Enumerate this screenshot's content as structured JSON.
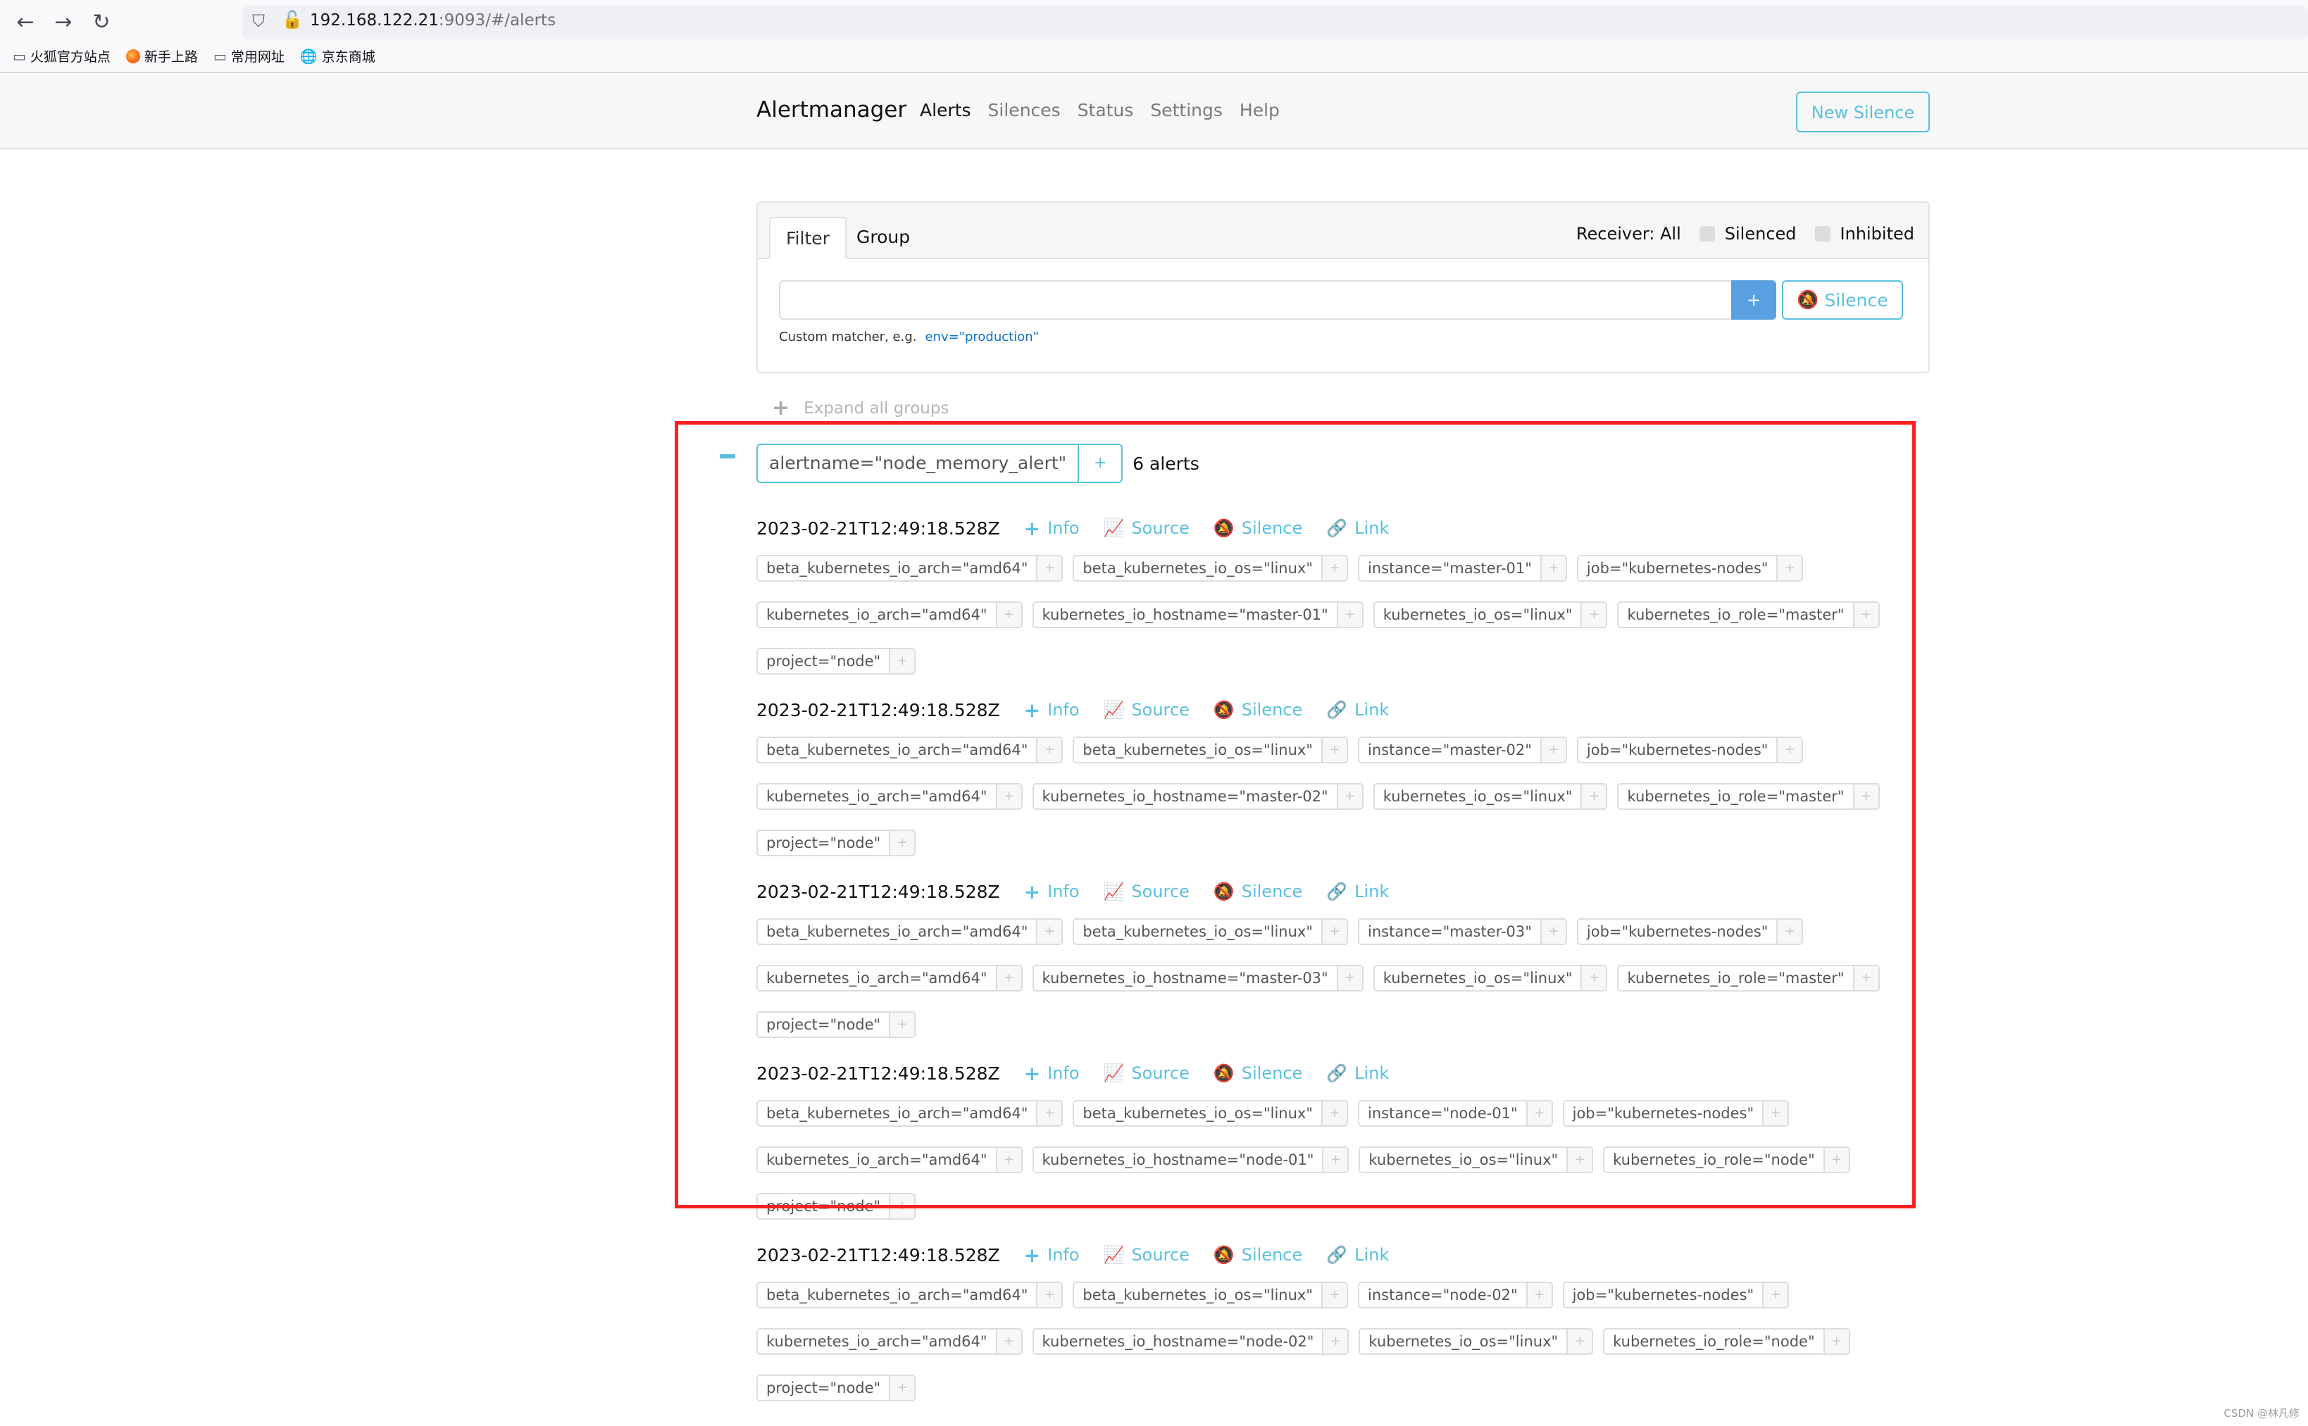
{
  "browser": {
    "url_host": "192.168.122.21",
    "url_rest": ":9093/#/alerts",
    "bookmarks": [
      {
        "label": "火狐官方站点",
        "icon": "folder-icon"
      },
      {
        "label": "新手上路",
        "icon": "firefox-icon"
      },
      {
        "label": "常用网址",
        "icon": "folder-icon"
      },
      {
        "label": "京东商城",
        "icon": "globe-icon"
      }
    ]
  },
  "navbar": {
    "brand": "Alertmanager",
    "links": [
      "Alerts",
      "Silences",
      "Status",
      "Settings",
      "Help"
    ],
    "new_silence": "New Silence"
  },
  "filter": {
    "tabs": [
      "Filter",
      "Group"
    ],
    "receiver": "Receiver: All",
    "silenced": "Silenced",
    "inhibited": "Inhibited",
    "input_value": "",
    "add_label": "+",
    "silence_label": "Silence",
    "hint_text": "Custom matcher, e.g.",
    "hint_code": "env=\"production\""
  },
  "expand_all": "Expand all groups",
  "group": {
    "label": "alertname=\"node_memory_alert\"",
    "add": "+",
    "count": "6 alerts"
  },
  "actions": {
    "info": "Info",
    "source": "Source",
    "silence": "Silence",
    "link": "Link"
  },
  "alerts": [
    {
      "time": "2023-02-21T12:49:18.528Z",
      "labels": [
        "beta_kubernetes_io_arch=\"amd64\"",
        "beta_kubernetes_io_os=\"linux\"",
        "instance=\"master-01\"",
        "job=\"kubernetes-nodes\"",
        "kubernetes_io_arch=\"amd64\"",
        "kubernetes_io_hostname=\"master-01\"",
        "kubernetes_io_os=\"linux\"",
        "kubernetes_io_role=\"master\"",
        "project=\"node\""
      ]
    },
    {
      "time": "2023-02-21T12:49:18.528Z",
      "labels": [
        "beta_kubernetes_io_arch=\"amd64\"",
        "beta_kubernetes_io_os=\"linux\"",
        "instance=\"master-02\"",
        "job=\"kubernetes-nodes\"",
        "kubernetes_io_arch=\"amd64\"",
        "kubernetes_io_hostname=\"master-02\"",
        "kubernetes_io_os=\"linux\"",
        "kubernetes_io_role=\"master\"",
        "project=\"node\""
      ]
    },
    {
      "time": "2023-02-21T12:49:18.528Z",
      "labels": [
        "beta_kubernetes_io_arch=\"amd64\"",
        "beta_kubernetes_io_os=\"linux\"",
        "instance=\"master-03\"",
        "job=\"kubernetes-nodes\"",
        "kubernetes_io_arch=\"amd64\"",
        "kubernetes_io_hostname=\"master-03\"",
        "kubernetes_io_os=\"linux\"",
        "kubernetes_io_role=\"master\"",
        "project=\"node\""
      ]
    },
    {
      "time": "2023-02-21T12:49:18.528Z",
      "labels": [
        "beta_kubernetes_io_arch=\"amd64\"",
        "beta_kubernetes_io_os=\"linux\"",
        "instance=\"node-01\"",
        "job=\"kubernetes-nodes\"",
        "kubernetes_io_arch=\"amd64\"",
        "kubernetes_io_hostname=\"node-01\"",
        "kubernetes_io_os=\"linux\"",
        "kubernetes_io_role=\"node\"",
        "project=\"node\""
      ]
    },
    {
      "time": "2023-02-21T12:49:18.528Z",
      "labels": [
        "beta_kubernetes_io_arch=\"amd64\"",
        "beta_kubernetes_io_os=\"linux\"",
        "instance=\"node-02\"",
        "job=\"kubernetes-nodes\"",
        "kubernetes_io_arch=\"amd64\"",
        "kubernetes_io_hostname=\"node-02\"",
        "kubernetes_io_os=\"linux\"",
        "kubernetes_io_role=\"node\"",
        "project=\"node\""
      ]
    }
  ],
  "colors": {
    "accent": "#5bc0de",
    "primary": "#59a0e0",
    "highlight": "#ff1f1f"
  },
  "watermark": "CSDN @林凡修"
}
